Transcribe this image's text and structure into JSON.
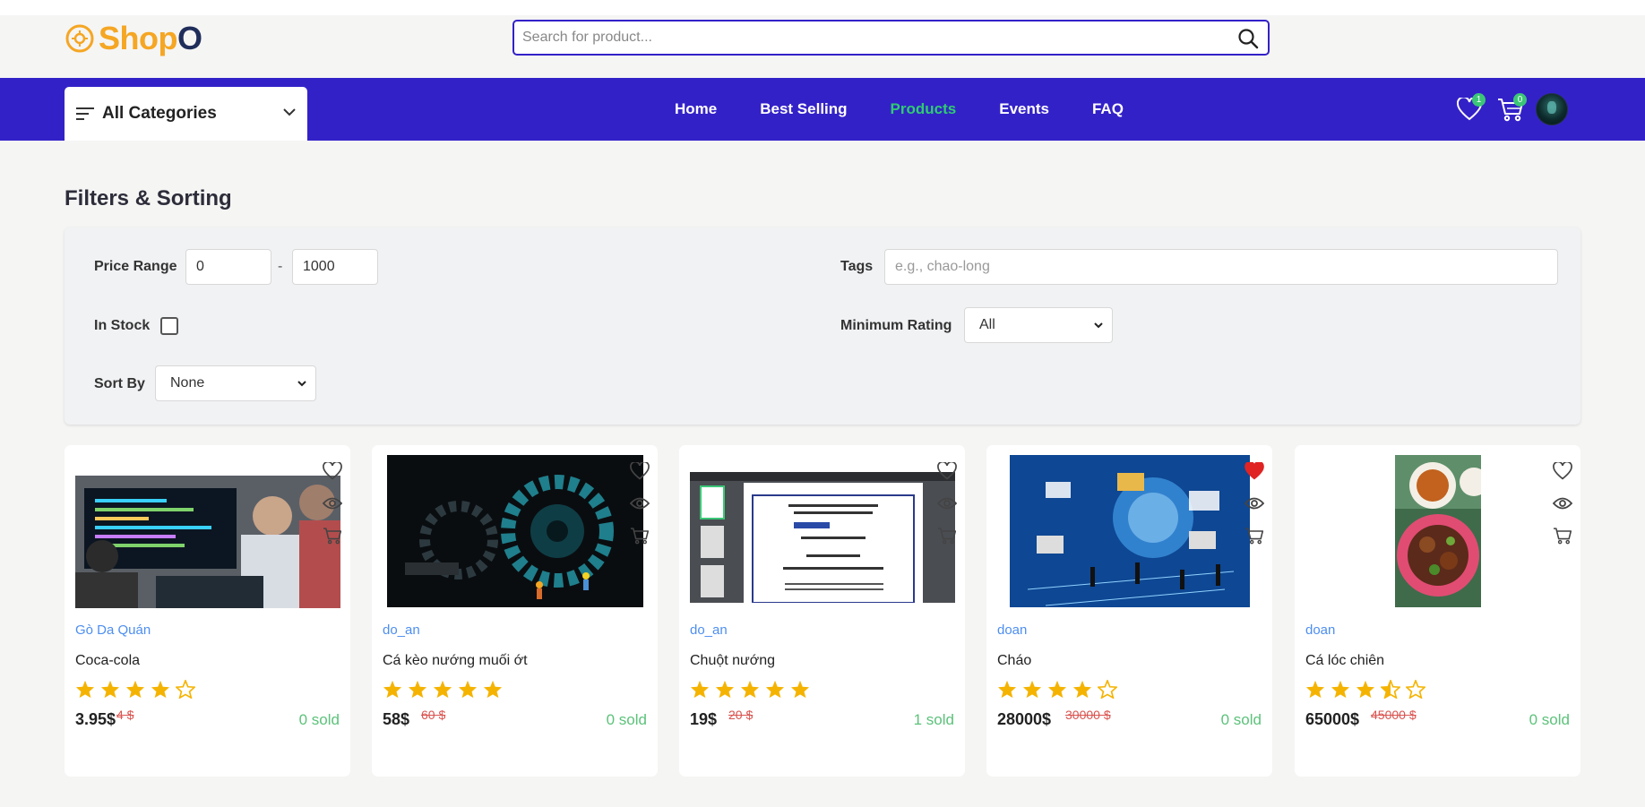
{
  "header": {
    "logo_text_a": "Shop",
    "logo_text_b": "O",
    "search_placeholder": "Search for product..."
  },
  "navbar": {
    "categories_label": "All Categories",
    "links": [
      {
        "label": "Home",
        "active": false
      },
      {
        "label": "Best Selling",
        "active": false
      },
      {
        "label": "Products",
        "active": true
      },
      {
        "label": "Events",
        "active": false
      },
      {
        "label": "FAQ",
        "active": false
      }
    ],
    "wishlist_count": "1",
    "cart_count": "0",
    "active_color": "#2ecc71",
    "bar_color": "#3321c8"
  },
  "filters": {
    "title": "Filters & Sorting",
    "price_range_label": "Price Range",
    "price_min": "0",
    "price_max": "1000",
    "dash": "-",
    "tags_label": "Tags",
    "tags_placeholder": "e.g., chao-long",
    "in_stock_label": "In Stock",
    "min_rating_label": "Minimum Rating",
    "min_rating_value": "All",
    "sort_by_label": "Sort By",
    "sort_by_value": "None"
  },
  "products": [
    {
      "shop": "Gò Da Quán",
      "name": "Coca-cola",
      "rating": 4,
      "price": "3.95$",
      "old_price": "4 $",
      "sold": "0 sold",
      "wishlisted": false,
      "image": "programmers-at-monitor"
    },
    {
      "shop": "do_an",
      "name": "Cá kèo nướng muối ớt",
      "rating": 5,
      "price": "58$",
      "old_price": "60 $",
      "sold": "0 sold",
      "wishlisted": false,
      "image": "gears-with-workers"
    },
    {
      "shop": "do_an",
      "name": "Chuột nướng",
      "rating": 5,
      "price": "19$",
      "old_price": "20 $",
      "sold": "1 sold",
      "wishlisted": false,
      "image": "pdf-document-screenshot"
    },
    {
      "shop": "doan",
      "name": "Cháo",
      "rating": 4,
      "price": "28000$",
      "old_price": "30000 $",
      "sold": "0 sold",
      "wishlisted": true,
      "image": "digital-network-people"
    },
    {
      "shop": "doan",
      "name": "Cá lóc chiên",
      "rating": 3.5,
      "price": "65000$",
      "old_price": "45000 $",
      "sold": "0 sold",
      "wishlisted": false,
      "image": "fried-fish-dish"
    }
  ]
}
